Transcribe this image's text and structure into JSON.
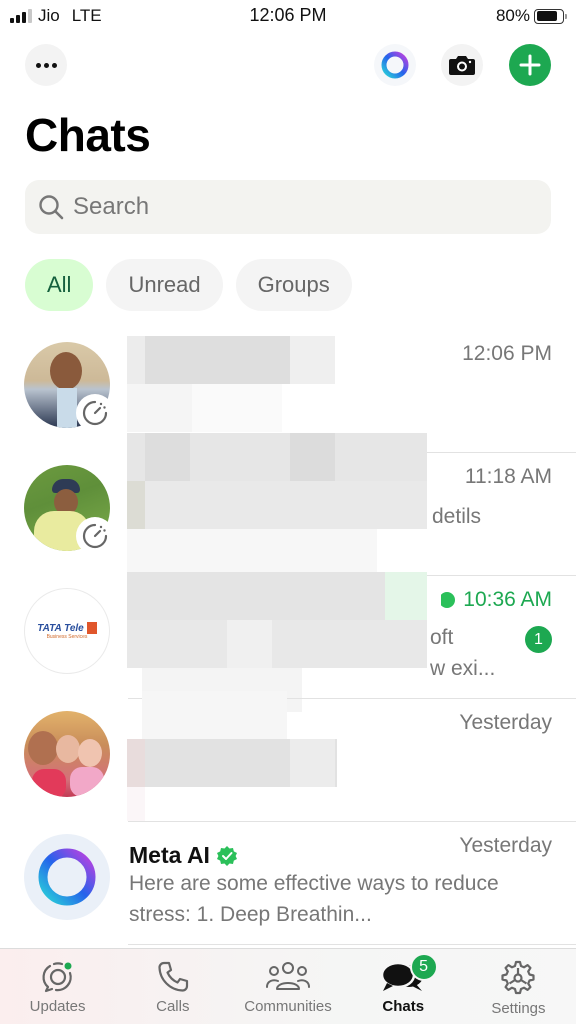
{
  "status_bar": {
    "carrier": "Jio",
    "network": "LTE",
    "time": "12:06 PM",
    "battery": "80%",
    "battery_level": 0.8
  },
  "header": {
    "title": "Chats",
    "actions": [
      {
        "name": "more-options",
        "icon": "ellipsis-icon"
      },
      {
        "name": "meta-ai",
        "icon": "meta-ai-ring-icon"
      },
      {
        "name": "camera",
        "icon": "camera-icon"
      },
      {
        "name": "new-chat",
        "icon": "plus-icon"
      }
    ]
  },
  "search": {
    "placeholder": "Search",
    "value": ""
  },
  "filters": [
    {
      "label": "All",
      "active": true
    },
    {
      "label": "Unread",
      "active": false
    },
    {
      "label": "Groups",
      "active": false
    }
  ],
  "chats": [
    {
      "name": "",
      "time": "12:06 PM",
      "preview": "",
      "avatar": "photo-man-blazer",
      "status_ring": "timer-icon",
      "unread": 0,
      "redacted": true
    },
    {
      "name": "…",
      "time": "11:18 AM",
      "preview": "detils",
      "avatar": "photo-man-cap",
      "status_ring": "timer-icon",
      "unread": 0,
      "redacted": true
    },
    {
      "name": "",
      "time": "10:36 AM",
      "preview_line1": "oft",
      "preview_line2": "w exi...",
      "avatar": "tata-tele-logo",
      "avatar_text": "TATA Tele",
      "avatar_subtext": "Business Services",
      "verified": true,
      "unread": 1,
      "redacted": true
    },
    {
      "name": "",
      "time": "Yesterday",
      "preview": "",
      "avatar": "photo-family",
      "unread": 0,
      "redacted": true
    },
    {
      "name": "Meta AI",
      "time": "Yesterday",
      "preview": "Here are some effective ways to reduce stress:   1. Deep Breathin...",
      "avatar": "meta-ai-ring",
      "verified": true,
      "unread": 0,
      "redacted": false
    }
  ],
  "tabbar": {
    "tabs": [
      {
        "label": "Updates",
        "icon": "updates-icon",
        "active": false
      },
      {
        "label": "Calls",
        "icon": "phone-icon",
        "active": false
      },
      {
        "label": "Communities",
        "icon": "communities-icon",
        "active": false
      },
      {
        "label": "Chats",
        "icon": "chats-icon",
        "active": true,
        "badge": "5"
      },
      {
        "label": "Settings",
        "icon": "gear-icon",
        "active": false
      }
    ]
  },
  "colors": {
    "accent": "#1da851",
    "chip_active_bg": "#d8fdd2",
    "chip_active_text": "#15603e"
  }
}
